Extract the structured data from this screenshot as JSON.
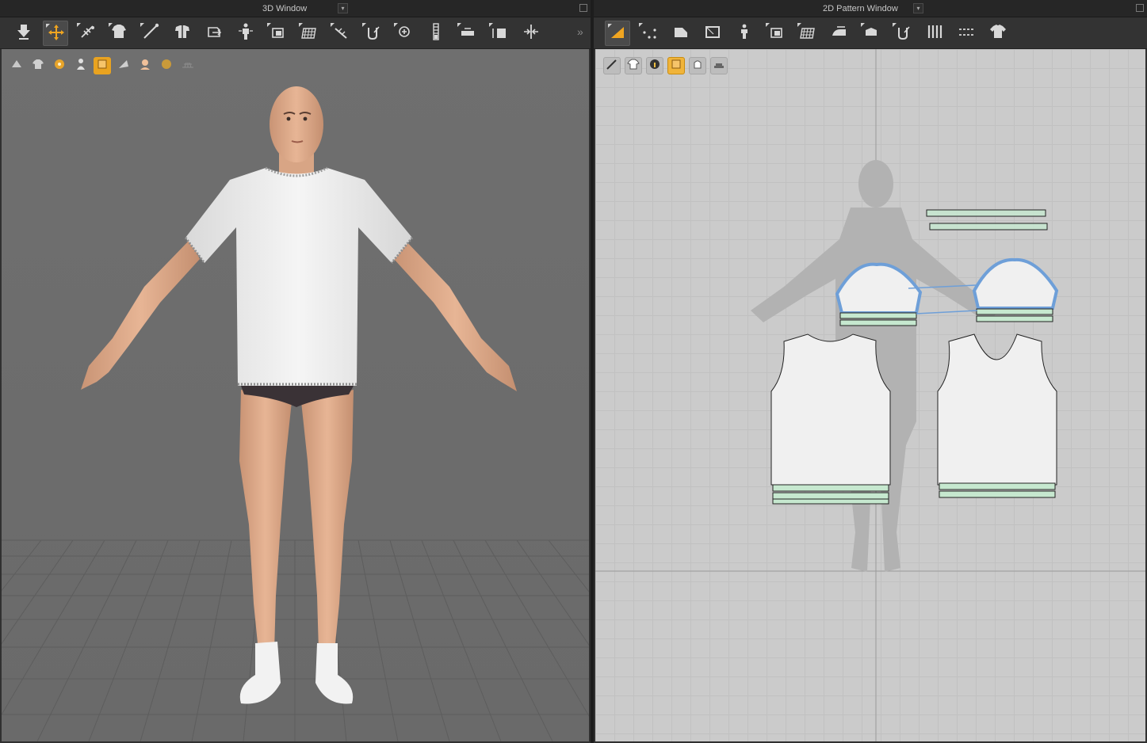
{
  "window_3d": {
    "title": "3D Window",
    "dropdown_glyph": "▾",
    "collapse_glyph": "»",
    "toolbar": [
      {
        "name": "simulate",
        "icon": "simulate-arrow-icon"
      },
      {
        "name": "select-move",
        "icon": "select-move-icon",
        "active": true
      },
      {
        "name": "select-mesh",
        "icon": "select-mesh-icon"
      },
      {
        "name": "fold-tack",
        "icon": "garment-tack-icon"
      },
      {
        "name": "line-measure",
        "icon": "line-measure-icon"
      },
      {
        "name": "fold-arrangement",
        "icon": "fold-arrangement-icon"
      },
      {
        "name": "reset-2d",
        "icon": "reset-2d-icon"
      },
      {
        "name": "arrangement-points",
        "icon": "avatar-arrangement-icon"
      },
      {
        "name": "fit-to-avatar",
        "icon": "fit-to-avatar-icon"
      },
      {
        "name": "grid-pattern",
        "icon": "grid-pattern-icon"
      },
      {
        "name": "strengthen",
        "icon": "strengthen-icon"
      },
      {
        "name": "tack-on-avatar",
        "icon": "tack-on-avatar-icon"
      },
      {
        "name": "pin",
        "icon": "pin-icon"
      },
      {
        "name": "zipper",
        "icon": "zipper-icon"
      },
      {
        "name": "button",
        "icon": "button-icon"
      },
      {
        "name": "buttonhole",
        "icon": "buttonhole-icon"
      },
      {
        "name": "gap-measure",
        "icon": "gap-measure-icon"
      }
    ],
    "view_tools": [
      {
        "name": "avatar-view",
        "icon": "avatar-view-icon"
      },
      {
        "name": "garment-view",
        "icon": "garment-view-icon"
      },
      {
        "name": "texture-view",
        "icon": "texture-view-icon"
      },
      {
        "name": "avatar-display",
        "icon": "avatar-display-icon"
      },
      {
        "name": "fabric-render",
        "icon": "fabric-render-icon",
        "active": true
      },
      {
        "name": "shading",
        "icon": "shading-icon"
      },
      {
        "name": "skin-display",
        "icon": "skin-display-icon"
      },
      {
        "name": "lighting",
        "icon": "lighting-icon"
      },
      {
        "name": "floor-toggle",
        "icon": "floor-icon",
        "disabled": true
      }
    ]
  },
  "window_2d": {
    "title": "2D Pattern Window",
    "dropdown_glyph": "▾",
    "toolbar": [
      {
        "name": "transform-pattern",
        "icon": "transform-pattern-icon",
        "active": true
      },
      {
        "name": "edit-points",
        "icon": "edit-points-icon"
      },
      {
        "name": "polygon",
        "icon": "polygon-icon"
      },
      {
        "name": "rectangle",
        "icon": "rectangle-icon"
      },
      {
        "name": "dart",
        "icon": "dart-icon"
      },
      {
        "name": "internal-polygon",
        "icon": "internal-polygon-icon"
      },
      {
        "name": "grid-pattern",
        "icon": "grid-pattern-icon"
      },
      {
        "name": "steam",
        "icon": "steam-iron-icon"
      },
      {
        "name": "segment-sewing",
        "icon": "segment-sewing-icon"
      },
      {
        "name": "free-sewing",
        "icon": "free-sewing-icon"
      },
      {
        "name": "pleats",
        "icon": "pleats-icon"
      },
      {
        "name": "topstitch",
        "icon": "topstitch-icon"
      },
      {
        "name": "garment-shirt",
        "icon": "t-shirt-icon"
      }
    ],
    "view_tools": [
      {
        "name": "show-seam-lines",
        "icon": "pen-icon"
      },
      {
        "name": "show-garment",
        "icon": "garment-outline-icon"
      },
      {
        "name": "pattern-info",
        "icon": "info-icon"
      },
      {
        "name": "texture-display",
        "icon": "texture-sheet-icon",
        "active": true
      },
      {
        "name": "lock-view",
        "icon": "lock-garment-icon"
      },
      {
        "name": "layer-order",
        "icon": "layer-stack-icon"
      }
    ]
  },
  "colors": {
    "accent": "#e9a320",
    "selection": "#6e9fd8",
    "binding": "#c6e8cf",
    "fabric": "#f0f0f0"
  }
}
